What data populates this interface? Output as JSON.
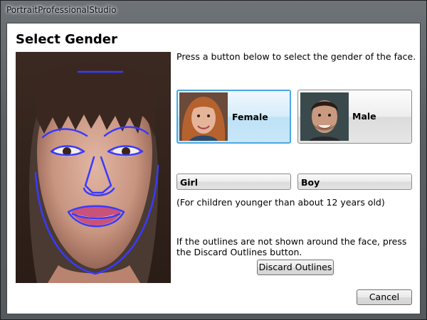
{
  "window": {
    "title": "PortraitProfessionalStudio"
  },
  "dialog": {
    "heading": "Select Gender",
    "instruction": "Press a button below to select the gender of the face.",
    "gender_buttons": [
      {
        "label": "Female",
        "selected": true
      },
      {
        "label": "Male",
        "selected": false
      }
    ],
    "child_buttons": [
      {
        "label": "Girl"
      },
      {
        "label": "Boy"
      }
    ],
    "children_note": "(For children younger than about 12 years old)",
    "discard_note": "If the outlines are not shown around the face, press the Discard Outlines button.",
    "discard_button": "Discard Outlines",
    "cancel_button": "Cancel"
  },
  "colors": {
    "outline": "#3a3aff",
    "selected_border": "#4aa8e0"
  },
  "icons": {
    "portrait": "face-photo-with-outlines",
    "female_thumb": "female-face-thumbnail",
    "male_thumb": "male-face-thumbnail"
  }
}
